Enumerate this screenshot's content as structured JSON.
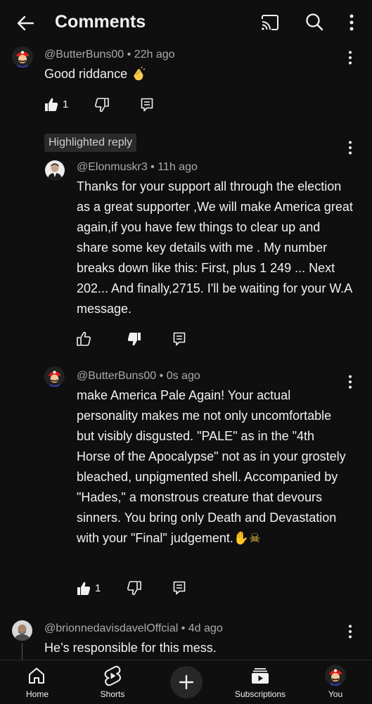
{
  "header": {
    "title": "Comments"
  },
  "comments": [
    {
      "author": "@ButterBuns00",
      "meta": " • 22h ago",
      "text": "Good riddance",
      "likes": "1"
    },
    {
      "badge": "Highlighted reply",
      "author": "@Elonmuskr3",
      "meta": " • 11h ago",
      "text": "Thanks for your support  all through the election as a great supporter ,We will make America great again,if you have few things to clear up and share some key details with me . My number breaks down like this: First, plus 1 249 ... Next 202... And finally,2715. I'll be waiting for your W.A message.",
      "likes": ""
    },
    {
      "author": "@ButterBuns00",
      "meta": " • 0s ago",
      "text": "make America Pale Again! Your actual personality makes me not only uncomfortable but visibly disgusted. \"PALE\" as in the \"4th Horse of the Apocalypse\" not as in your grostely bleached, unpigmented shell. Accompanied by \"Hades,\" a monstrous creature that devours sinners. You bring only Death and Devastation with your \"Final\" judgement.",
      "emoji": "✋☠",
      "likes": "1"
    },
    {
      "author": "@brionnedavisdavelOffcial",
      "meta": " • 4d ago",
      "text": "He’s responsible for this mess."
    }
  ],
  "nav": {
    "home": "Home",
    "shorts": "Shorts",
    "subscriptions": "Subscriptions",
    "you": "You"
  },
  "colors": {
    "background": "#0f0f0f",
    "badge_bg": "#2a2a2a",
    "meta_text": "#aaaaaa"
  },
  "icons": [
    "back-arrow-icon",
    "cast-icon",
    "search-icon",
    "more-vert-icon",
    "thumb-up-icon",
    "thumb-down-icon",
    "reply-icon",
    "home-icon",
    "shorts-icon",
    "create-plus-icon",
    "subscriptions-icon"
  ]
}
